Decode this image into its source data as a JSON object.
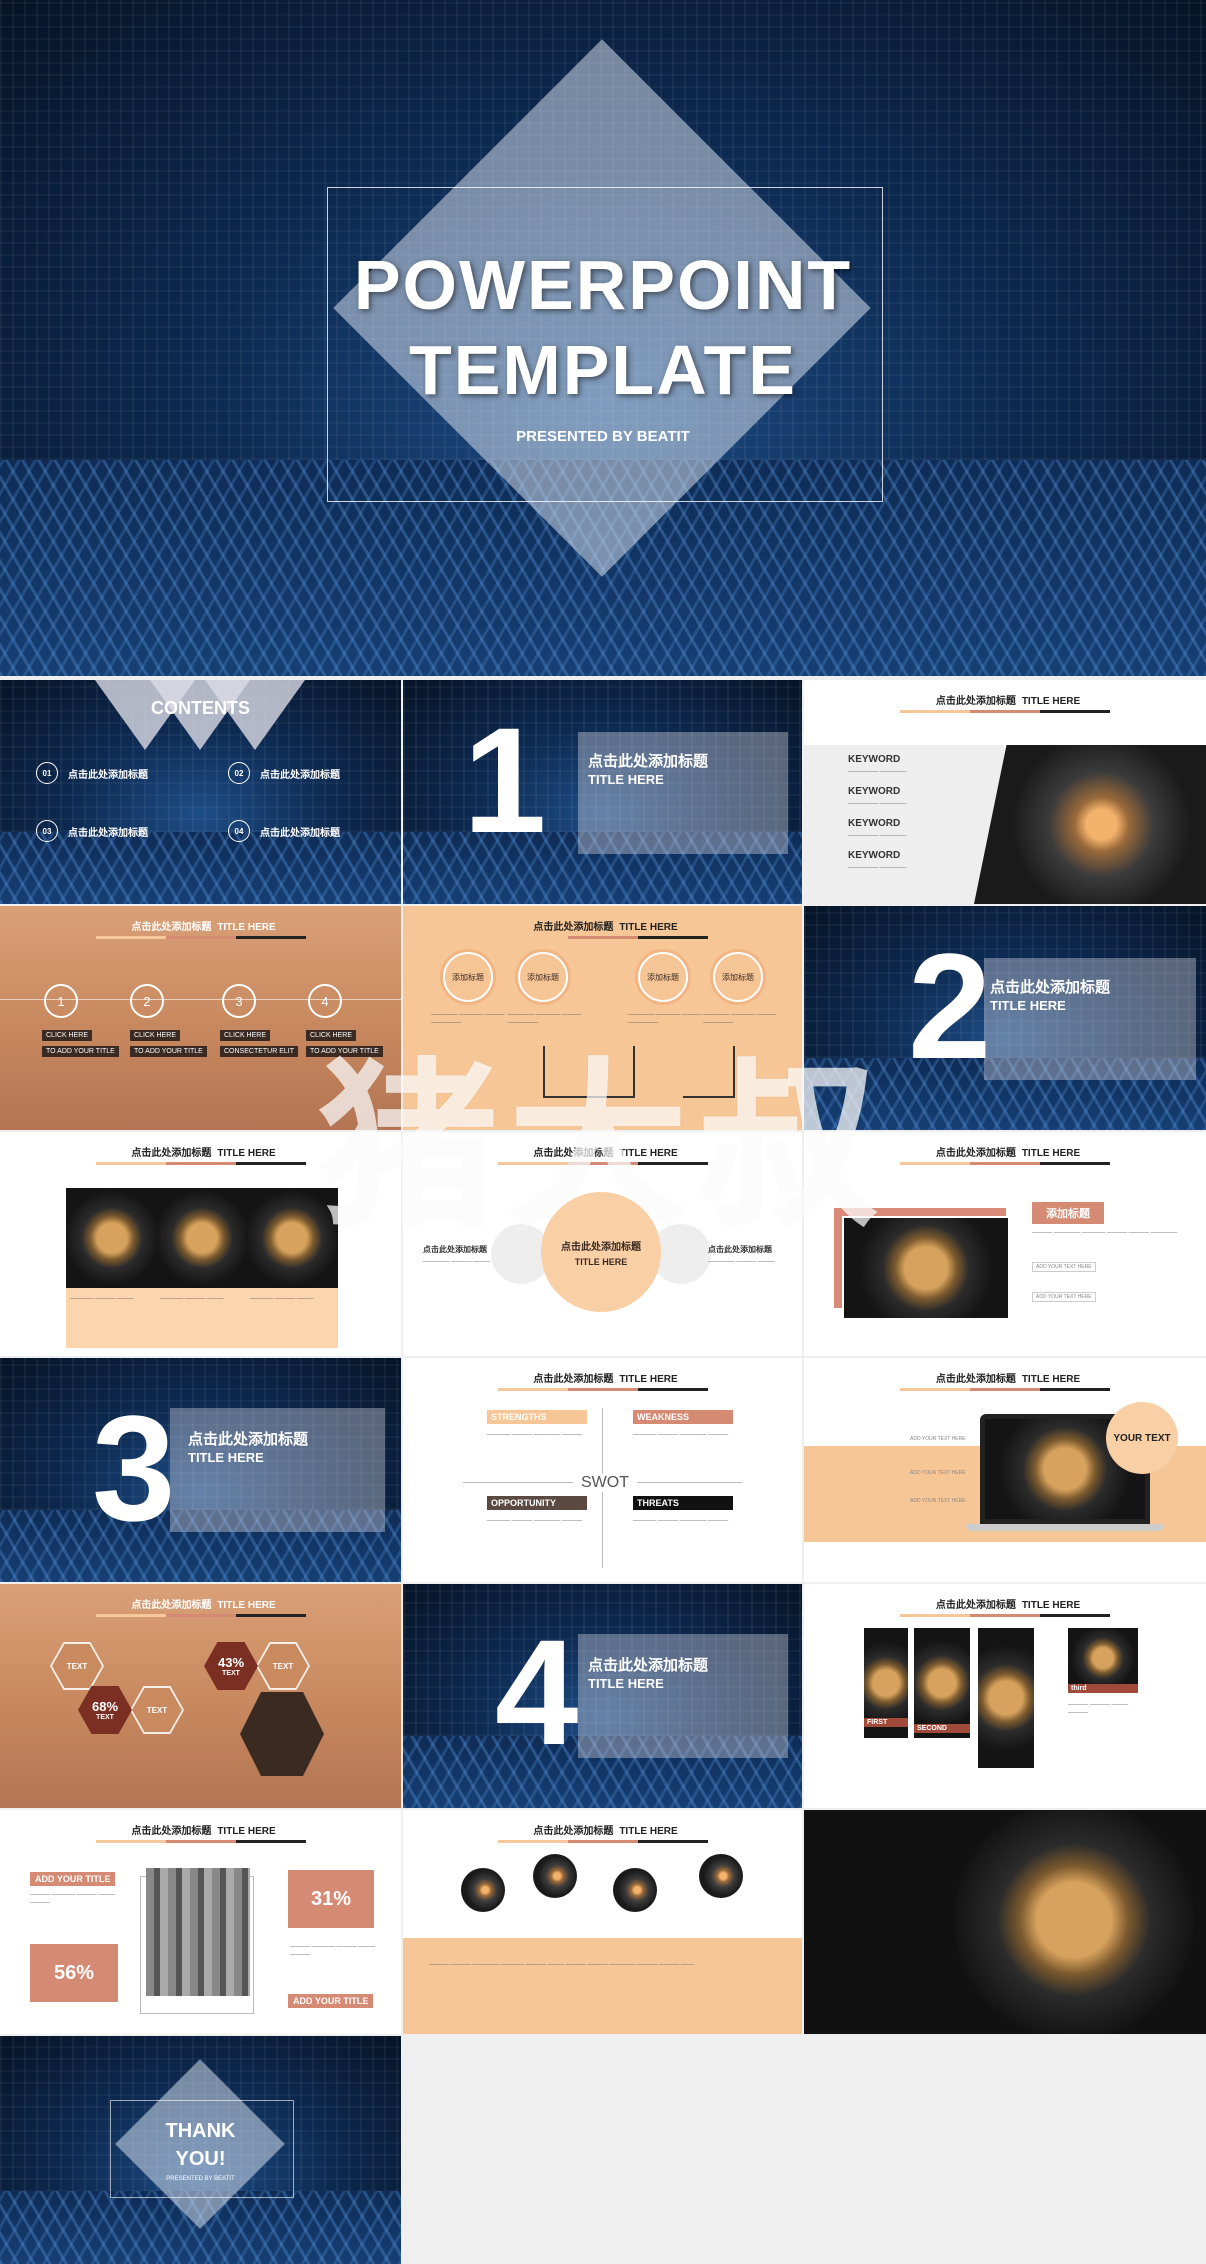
{
  "cover": {
    "title_line1": "POWERPOINT",
    "title_line2": "TEMPLATE",
    "subtitle": "PRESENTED BY BEATIT"
  },
  "contents": {
    "title": "CONTENTS",
    "items": [
      {
        "num": "01",
        "label": "点击此处添加标题"
      },
      {
        "num": "02",
        "label": "点击此处添加标题"
      },
      {
        "num": "03",
        "label": "点击此处添加标题"
      },
      {
        "num": "04",
        "label": "点击此处添加标题"
      }
    ]
  },
  "header": {
    "cn": "点击此处添加标题",
    "en": "TITLE HERE"
  },
  "sections": [
    {
      "num": "1",
      "cn": "点击此处添加标题",
      "en": "TITLE HERE"
    },
    {
      "num": "2",
      "cn": "点击此处添加标题",
      "en": "TITLE HERE"
    },
    {
      "num": "3",
      "cn": "点击此处添加标题",
      "en": "TITLE HERE"
    },
    {
      "num": "4",
      "cn": "点击此处添加标题",
      "en": "TITLE HERE"
    }
  ],
  "keyword": {
    "label": "KEYWORD"
  },
  "steps": {
    "nums": [
      "1",
      "2",
      "3",
      "4"
    ],
    "click": "CLICK HERE",
    "captions": [
      "TO ADD YOUR TITLE",
      "TO ADD YOUR TITLE",
      "CONSECTETUR ELIT",
      "TO ADD YOUR TITLE"
    ]
  },
  "circles": {
    "label": "添加标题"
  },
  "center_slide": {
    "cn": "点击此处添加标题",
    "en": "TITLE HERE"
  },
  "add_title_cn": "添加标题",
  "add_your_text": "ADD YOUR TEXT HERE",
  "swot": {
    "center": "SWOT",
    "strengths": "STRENGTHS",
    "weakness": "WEAKNESS",
    "opportunity": "OPPORTUNITY",
    "threats": "THREATS"
  },
  "laptop": {
    "badge": "YOUR TEXT"
  },
  "hexes": {
    "text": "TEXT",
    "p1": "43%",
    "p2": "68%"
  },
  "gallery": {
    "first": "FIRST",
    "second": "SECOND",
    "third": "third"
  },
  "stats": {
    "add_title": "ADD YOUR TITLE",
    "p1": "56%",
    "p2": "31%"
  },
  "thanks": {
    "line1": "THANK",
    "line2": "YOU!",
    "sub": "PRESENTED BY BEATIT"
  },
  "watermark": "猪大叔"
}
